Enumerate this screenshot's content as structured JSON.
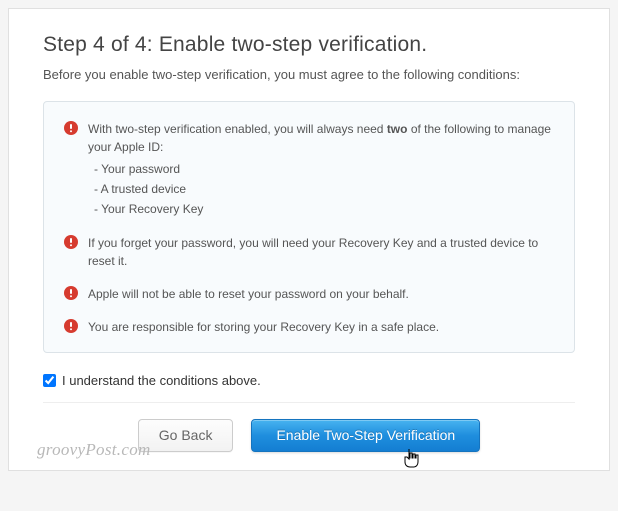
{
  "title": "Step 4 of 4: Enable two-step verification.",
  "intro": "Before you enable two-step verification, you must agree to the following conditions:",
  "conditions": [
    {
      "lead": "With two-step verification enabled, you will always need ",
      "bold": "two",
      "trail": " of the following to manage your Apple ID:",
      "sub": [
        "- Your password",
        "- A trusted device",
        "- Your Recovery Key"
      ]
    },
    {
      "text": "If you forget your password, you will need your Recovery Key and a trusted device to reset it."
    },
    {
      "text": "Apple will not be able to reset your password on your behalf."
    },
    {
      "text": "You are responsible for storing your Recovery Key in a safe place."
    }
  ],
  "agree": {
    "label": "I understand the conditions above.",
    "checked": true
  },
  "buttons": {
    "back": "Go Back",
    "enable": "Enable Two-Step Verification"
  },
  "watermark": "groovyPost.com"
}
